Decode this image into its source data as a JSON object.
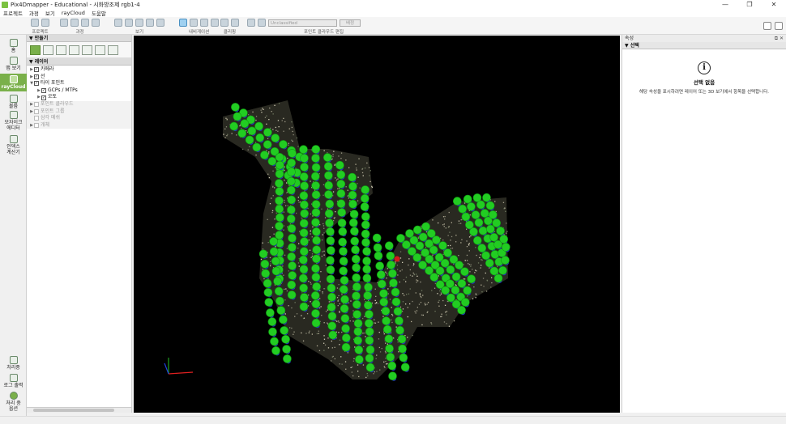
{
  "window": {
    "title": "Pix4Dmapper - Educational - 시화방조제 rgb1-4",
    "controls": [
      "—",
      "❐",
      "✕"
    ]
  },
  "menu": [
    "프로젝트",
    "과정",
    "보기",
    "rayCloud",
    "도움말"
  ],
  "toolbar": {
    "groups": [
      {
        "label": "프로젝트",
        "icons": 2
      },
      {
        "label": "과정",
        "icons": 4
      },
      {
        "label": "보기",
        "icons": 5
      },
      {
        "label": "내비게이션",
        "icons": 4
      },
      {
        "label": "클리핑",
        "icons": 2
      },
      {
        "label": "포인트 클라우드 편집",
        "icons": 2
      }
    ],
    "classification_value": "Unclassified",
    "assign_button": "배정"
  },
  "sidenav": {
    "items": [
      {
        "label": "홈",
        "label2": ""
      },
      {
        "label": "맵 보기",
        "label2": ""
      },
      {
        "label": "rayCloud",
        "label2": "",
        "active": true
      },
      {
        "label": "볼륨",
        "label2": ""
      },
      {
        "label": "모자이크",
        "label2": "에디터"
      },
      {
        "label": "인덱스",
        "label2": "계산기"
      }
    ],
    "bottom": [
      {
        "label": "처리중",
        "label2": ""
      },
      {
        "label": "로그 출력",
        "label2": ""
      },
      {
        "label": "처리 중",
        "label2": "옵션"
      }
    ]
  },
  "left_panel": {
    "create_header": "만들기",
    "layers_header": "레이어",
    "layers": [
      {
        "label": "카메라",
        "checked": true,
        "indent": 0,
        "expander": "▶",
        "dim": false
      },
      {
        "label": "선",
        "checked": true,
        "indent": 0,
        "expander": "▶",
        "dim": false
      },
      {
        "label": "타이 포인트",
        "checked": true,
        "indent": 0,
        "expander": "▼",
        "dim": false
      },
      {
        "label": "GCPs / MTPs",
        "checked": true,
        "indent": 1,
        "expander": "▶",
        "dim": false
      },
      {
        "label": "오토",
        "checked": true,
        "indent": 1,
        "expander": "▶",
        "dim": false
      },
      {
        "label": "포인트 클라우드",
        "checked": false,
        "indent": 0,
        "expander": "▶",
        "dim": true
      },
      {
        "label": "포인트 그룹",
        "checked": false,
        "indent": 0,
        "expander": "▶",
        "dim": true
      },
      {
        "label": "삼각 메쉬",
        "checked": false,
        "indent": 0,
        "expander": "",
        "dim": true
      },
      {
        "label": "개체",
        "checked": false,
        "indent": 0,
        "expander": "▶",
        "dim": true
      }
    ]
  },
  "right_panel": {
    "title": "속성",
    "section": "선택",
    "no_selection_title": "선택 없음",
    "no_selection_desc": "해당 속성을 표시하려면 레이어 또는 3D 보기에서 항목을 선택합니다."
  },
  "colors": {
    "accent_green": "#7ab04a",
    "camera_green": "#22cc22",
    "camera_blue": "#2233cc",
    "viewport_bg": "#000000"
  }
}
